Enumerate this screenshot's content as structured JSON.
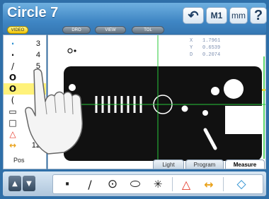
{
  "header": {
    "title": "Circle 7",
    "m1_label": "M1",
    "units_label": "mm",
    "help_label": "?",
    "tabs": [
      {
        "label": "VIDEO",
        "active": true
      },
      {
        "label": "DRO",
        "active": false
      },
      {
        "label": "VIEW",
        "active": false
      },
      {
        "label": "TOL",
        "active": false
      }
    ]
  },
  "feature_list": {
    "items": [
      {
        "icon": "point-icon",
        "glyph": "·",
        "number": "3"
      },
      {
        "icon": "point-icon",
        "glyph": "·",
        "number": "4"
      },
      {
        "icon": "line-icon",
        "glyph": "/",
        "number": "5"
      },
      {
        "icon": "circle-icon",
        "glyph": "O",
        "number": "6"
      },
      {
        "icon": "circle-icon",
        "glyph": "O",
        "number": "7",
        "selected": true
      },
      {
        "icon": "arc-icon",
        "glyph": "(",
        "number": "8"
      },
      {
        "icon": "slot-icon",
        "glyph": "▭",
        "number": "9"
      },
      {
        "icon": "rectangle-icon",
        "glyph": "□",
        "number": "10"
      },
      {
        "icon": "angle-icon",
        "glyph": "△",
        "number": "11"
      },
      {
        "icon": "distance-icon",
        "glyph": "↔",
        "number": "12"
      }
    ],
    "footer_label": "Pos"
  },
  "readout": {
    "x_label": "X",
    "x_value": "1.7961",
    "y_label": "Y",
    "y_value": "0.6539",
    "d_label": "D",
    "d_value": "0.2074"
  },
  "view_tabs": [
    {
      "label": "Light",
      "active": false
    },
    {
      "label": "Program",
      "active": false
    },
    {
      "label": "Measure",
      "active": true
    }
  ],
  "toolbar": {
    "tools": [
      {
        "name": "point-tool",
        "glyph": "·"
      },
      {
        "name": "line-tool",
        "glyph": "/"
      },
      {
        "name": "circle-tool",
        "glyph": "⊙"
      },
      {
        "name": "slot-tool",
        "glyph": "⬭"
      },
      {
        "name": "auto-tool",
        "glyph": "✳"
      },
      {
        "name": "angle-tool",
        "glyph": "△"
      },
      {
        "name": "distance-tool",
        "glyph": "↔"
      },
      {
        "name": "skew-tool",
        "glyph": "◇"
      }
    ]
  },
  "colors": {
    "frame": "#2f6fa8",
    "accent_selected": "#fff27a",
    "part": "#111111",
    "crosshair": "#27c83a",
    "angle_icon": "#e43a2a",
    "distance_icon": "#e9a21b",
    "skew_icon": "#2a8fd0"
  }
}
